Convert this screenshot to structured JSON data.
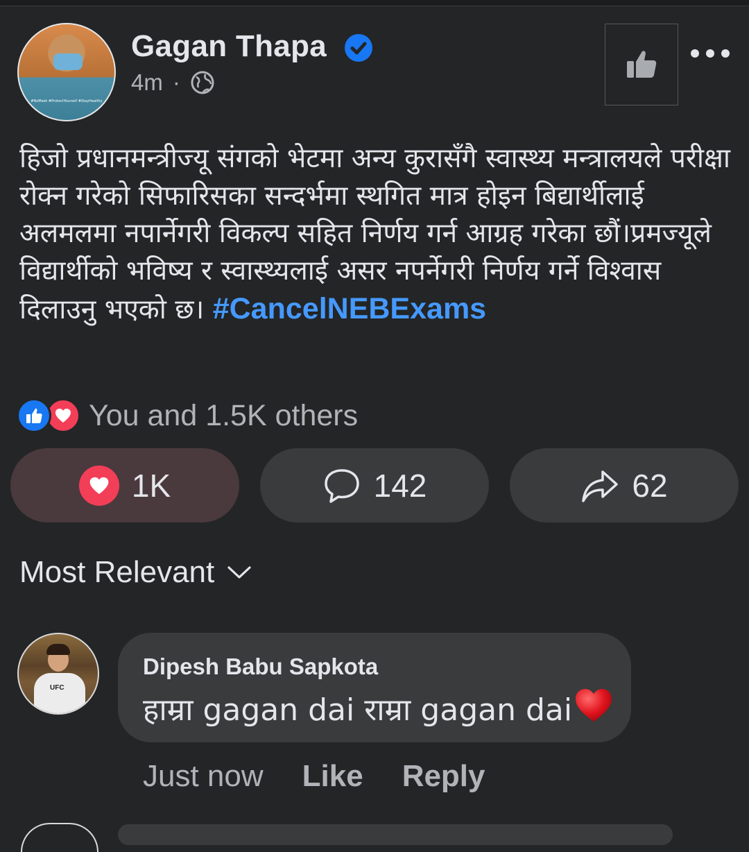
{
  "post": {
    "author": "Gagan Thapa",
    "time": "4m",
    "separator": "·",
    "body": "हिजो प्रधानमन्त्रीज्यू संगको भेटमा अन्य कुरासँगै स्वास्थ्य मन्त्रालयले परीक्षा रोक्न गरेको सिफारिसका सन्दर्भमा स्थगित मात्र होइन बिद्यार्थीलाई अलमलमा नपार्नेगरी विकल्प सहित निर्णय गर्न आग्रह गरेका छौं।प्रमज्यूले विद्यार्थीको भविष्य र स्वास्थ्यलाई असर नपर्नेगरी निर्णय गर्ने विश्वास दिलाउनु भएको छ। ",
    "hashtag": "#CancelNEBExams",
    "reactions_summary": "You and 1.5K others",
    "avatar_caption": "#NoMask #ProtectYourself #StayHealthy"
  },
  "actions": {
    "love_count": "1K",
    "comment_count": "142",
    "share_count": "62"
  },
  "sort": {
    "label": "Most Relevant"
  },
  "comment": {
    "author": "Dipesh Babu Sapkota",
    "text": "हाम्रा gagan dai राम्रा gagan dai",
    "time": "Just now",
    "like_label": "Like",
    "reply_label": "Reply",
    "avatar_logo": "UFC"
  },
  "colors": {
    "background": "#242526",
    "bubble": "#3a3b3c",
    "link": "#4599ff",
    "like_blue": "#1877f2",
    "love_red": "#f33e58"
  },
  "icons": {
    "verified": "verified-badge-icon",
    "privacy": "globe-icon",
    "like_page": "thumbs-up-icon",
    "more": "more-dots-icon",
    "comment": "comment-icon",
    "share": "share-arrow-icon",
    "sort": "chevron-down-icon"
  }
}
